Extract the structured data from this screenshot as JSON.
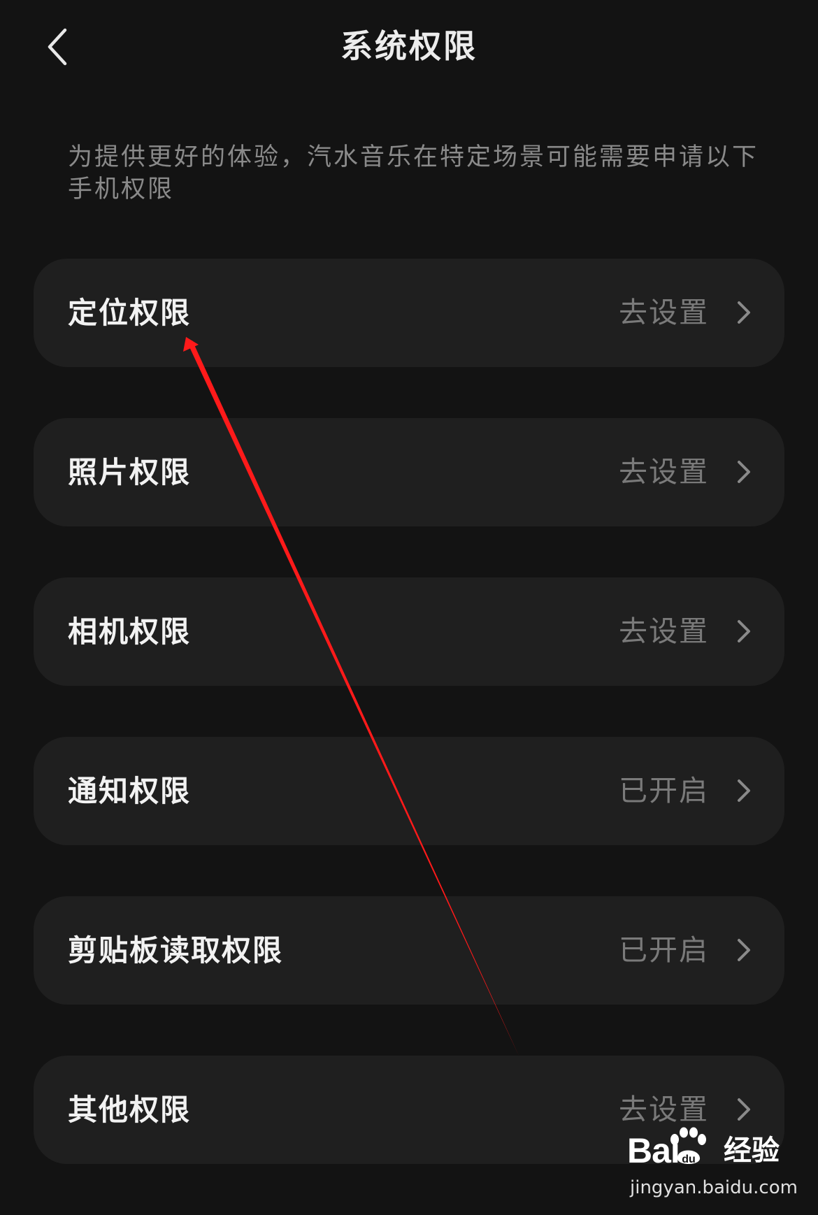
{
  "header": {
    "title": "系统权限"
  },
  "description": "为提供更好的体验，汽水音乐在特定场景可能需要申请以下手机权限",
  "permissions": [
    {
      "label": "定位权限",
      "status": "去设置"
    },
    {
      "label": "照片权限",
      "status": "去设置"
    },
    {
      "label": "相机权限",
      "status": "去设置"
    },
    {
      "label": "通知权限",
      "status": "已开启"
    },
    {
      "label": "剪贴板读取权限",
      "status": "已开启"
    },
    {
      "label": "其他权限",
      "status": "去设置"
    }
  ],
  "icons": {
    "back": "chevron-left-icon",
    "row_arrow": "chevron-right-icon",
    "watermark_paw": "paw-icon"
  },
  "colors": {
    "background": "#131313",
    "row_background": "#1f1f1f",
    "label": "#f2f2f2",
    "status": "#7a7a7a",
    "annotation_arrow": "#ff1a1a"
  },
  "watermark": {
    "brand_prefix": "Bai",
    "brand_suffix": "经验",
    "url": "jingyan.baidu.com"
  }
}
